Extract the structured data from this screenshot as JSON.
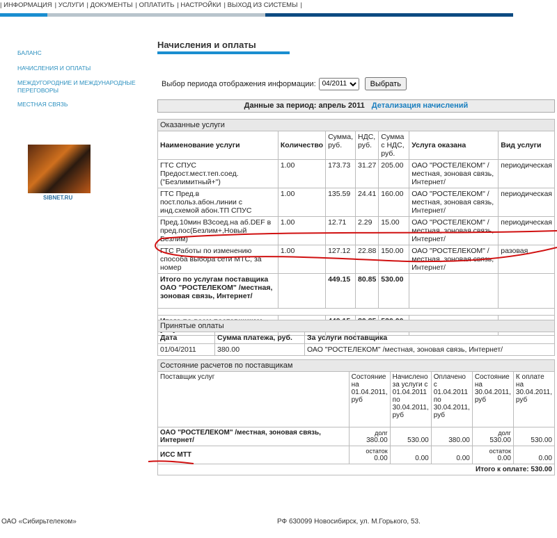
{
  "nav": [
    "ИНФОРМАЦИЯ",
    "УСЛУГИ",
    "ДОКУМЕНТЫ",
    "ОПЛАТИТЬ",
    "НАСТРОЙКИ",
    "ВЫХОД ИЗ СИСТЕМЫ"
  ],
  "sidebar": [
    "БАЛАНС",
    "НАЧИСЛЕНИЯ И ОПЛАТЫ",
    "МЕЖДУГОРОДНИЕ И МЕЖДУНАРОДНЫЕ ПЕРЕГОВОРЫ",
    "МЕСТНАЯ СВЯЗЬ"
  ],
  "banner_label": "SIBNET.RU",
  "title": "Начисления и оплаты",
  "period": {
    "label": "Выбор периода отображения информации:",
    "value": "04/2011",
    "button": "Выбрать"
  },
  "data_header": {
    "text": "Данные за период: апрель 2011",
    "link": "Детализация начислений"
  },
  "services": {
    "caption": "Оказанные услуги",
    "headers": [
      "Наименование услуги",
      "Количество",
      "Сумма, руб.",
      "НДС, руб.",
      "Сумма с НДС, руб.",
      "Услуга оказана",
      "Вид услуги"
    ],
    "rows": [
      [
        "ГТС СПУС Предост.мест.теп.соед. (\"Безлимитный+\")",
        "1.00",
        "173.73",
        "31.27",
        "205.00",
        "ОАО \"РОСТЕЛЕКОМ\" / местная, зоновая связь, Интернет/",
        "периодическая"
      ],
      [
        "ГТС Пред.в пост.польз.абон.линии с инд.схемой абон.ТП СПУС",
        "1.00",
        "135.59",
        "24.41",
        "160.00",
        "ОАО \"РОСТЕЛЕКОМ\" / местная, зоновая связь, Интернет/",
        "периодическая"
      ],
      [
        "Пред.10мин ВЗсоед.на аб.DEF в пред.пос(Безлим+,Новый Безлим)",
        "1.00",
        "12.71",
        "2.29",
        "15.00",
        "ОАО \"РОСТЕЛЕКОМ\" / местная, зоновая связь, Интернет/",
        "периодическая"
      ],
      [
        "ГТС Работы по изменению способа выбора сети МТС, за номер",
        "1.00",
        "127.12",
        "22.88",
        "150.00",
        "ОАО \"РОСТЕЛЕКОМ\" / местная, зоновая связь, Интернет/",
        "разовая"
      ]
    ],
    "subtotal": [
      "Итого по услугам поставщика ОАО \"РОСТЕЛЕКОМ\" /местная, зоновая связь, Интернет/",
      "449.15",
      "80.85",
      "530.00"
    ],
    "total": [
      "Итого по всем поставщикам услуг",
      "449.15",
      "80.85",
      "530.00"
    ]
  },
  "payments": {
    "caption": "Принятые оплаты",
    "headers": [
      "Дата",
      "Сумма платежа, руб.",
      "За услуги поставщика"
    ],
    "rows": [
      [
        "01/04/2011",
        "380.00",
        "ОАО \"РОСТЕЛЕКОМ\" /местная, зоновая связь, Интернет/"
      ]
    ]
  },
  "state": {
    "caption": "Состояние расчетов по поставщикам",
    "headers": [
      "Поставщик услуг",
      "Состояние на 01.04.2011, руб",
      "Начислено за услуги с 01.04.2011 по 30.04.2011, руб",
      "Оплачено с 01.04.2011 по 30.04.2011, руб",
      "Состояние на 30.04.2011, руб",
      "К оплате на 30.04.2011, руб"
    ],
    "rows": [
      [
        "ОАО \"РОСТЕЛЕКОМ\" /местная, зоновая связь, Интернет/",
        "долг",
        "380.00",
        "530.00",
        "380.00",
        "долг",
        "530.00",
        "530.00"
      ],
      [
        "ИСС МТТ",
        "остаток",
        "0.00",
        "0.00",
        "0.00",
        "остаток",
        "0.00",
        "0.00"
      ]
    ],
    "total": "Итого к оплате: 530.00"
  },
  "footer": {
    "left": "ОАО «Сибирьтелеком»",
    "right": "РФ 630099 Новосибирск, ул. М.Горького, 53."
  }
}
